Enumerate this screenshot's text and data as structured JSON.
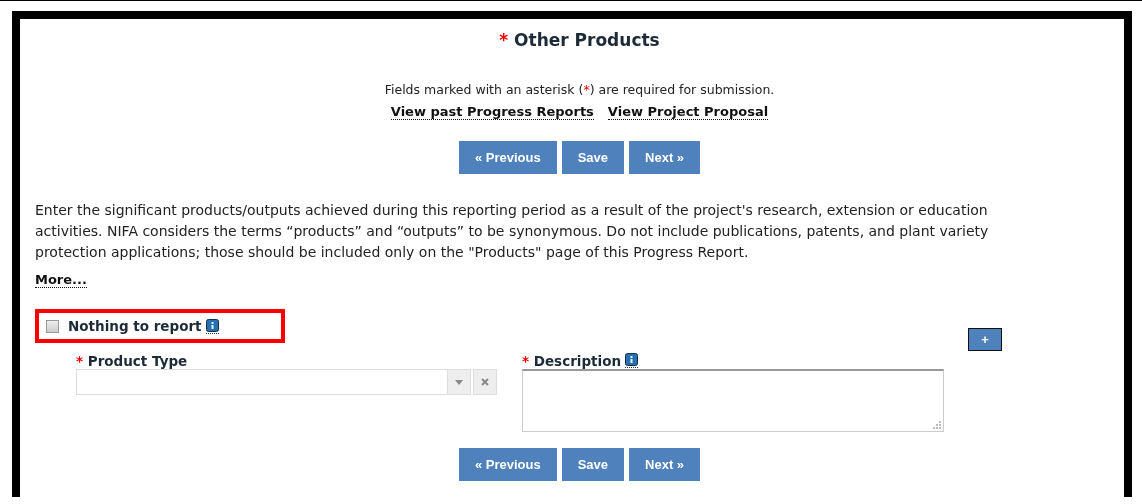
{
  "header": {
    "required_mark": "*",
    "title": "Other Products"
  },
  "note": {
    "before": "Fields marked with an asterisk (",
    "mark": "*",
    "after": ") are required for submission."
  },
  "links": [
    "View past Progress Reports",
    "View Project Proposal"
  ],
  "top_buttons": [
    "« Previous",
    "Save",
    "Next »"
  ],
  "instructions": "Enter the significant products/outputs achieved during this reporting period as a result of the project's research, extension or education activities.  NIFA considers the terms “products” and “outputs” to be synonymous.  Do not include publications, patents, and plant variety protection applications; those should be included only on the \"Products\" page of this Progress Report.",
  "more_link": "More...",
  "nothing_to_report": {
    "label": "Nothing to report",
    "checked": false,
    "highlighted": true
  },
  "fields": [
    {
      "kind": "select",
      "required_mark": "*",
      "label": "Product Type",
      "help": false
    },
    {
      "kind": "textarea",
      "required_mark": "*",
      "label": "Description",
      "help": true
    }
  ],
  "add_button": "+",
  "bottom_buttons": [
    "« Previous",
    "Save",
    "Next »"
  ]
}
